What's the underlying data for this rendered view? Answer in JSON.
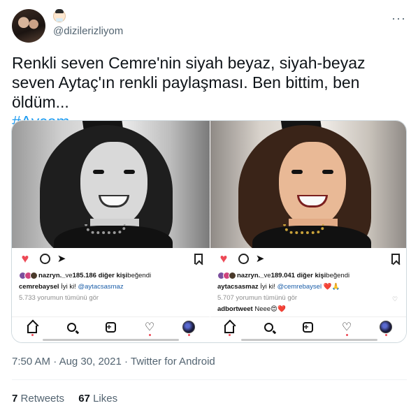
{
  "author": {
    "handle": "@dizilerizliyom",
    "avatar_icon": "profile-photo-couple",
    "name_emoji_icon": "person-emoji-icon"
  },
  "more_label": "···",
  "tweet": {
    "text": "Renkli seven Cemre'nin siyah beyaz, siyah-beyaz seven Aytaç'ın renkli paylaşması. Ben bittim, ben öldüm...",
    "hashtag": "#Aycem"
  },
  "posts": [
    {
      "photo": "black-and-white selfie",
      "likes_user": "nazryn._",
      "likes_mid": " ve ",
      "likes_count": "185.186 diğer kişi",
      "likes_suffix": " beğendi",
      "caption_user": "cemrebaysel",
      "caption_text": " İyi ki! ",
      "caption_mention": "@aytacsasmaz",
      "comments_link": "5.733 yorumun tümünü gör",
      "extra_comment_user": "",
      "extra_comment_text": ""
    },
    {
      "photo": "color selfie",
      "likes_user": "nazryn._",
      "likes_mid": " ve ",
      "likes_count": "189.041 diğer kişi",
      "likes_suffix": " beğendi",
      "caption_user": "aytacsasmaz",
      "caption_text": " İyi ki! ",
      "caption_mention": "@cemrebaysel",
      "caption_emoji": " ❤️🙏",
      "comments_link": "5.707 yorumun tümünü gör",
      "extra_comment_user": "adbortweet",
      "extra_comment_text": " Neee😍❤️"
    }
  ],
  "meta": {
    "time": "7:50 AM",
    "dot1": " · ",
    "date": "Aug 30, 2021",
    "dot2": " · ",
    "source": "Twitter for Android"
  },
  "stats": {
    "retweets_count": "7",
    "retweets_label": "Retweets",
    "likes_count": "67",
    "likes_label": "Likes"
  },
  "colors": {
    "text": "#0f1419",
    "muted": "#536471",
    "link": "#1d9bf0",
    "like_red": "#ed4956"
  }
}
